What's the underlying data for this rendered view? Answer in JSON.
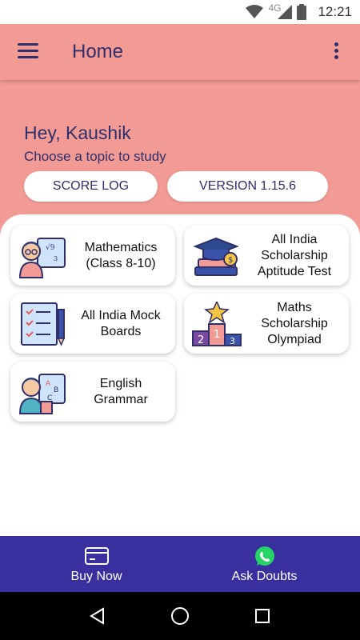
{
  "status_bar": {
    "network": "4G",
    "time": "12:21"
  },
  "app_bar": {
    "title": "Home"
  },
  "greeting": {
    "hello": "Hey, Kaushik",
    "subtitle": "Choose a topic to study"
  },
  "actions": {
    "score_log": "SCORE LOG",
    "version": "VERSION 1.15.6"
  },
  "topics": [
    {
      "label": "Mathematics (Class 8-10)",
      "icon": "student-math-icon"
    },
    {
      "label": "All India Scholarship Aptitude Test",
      "icon": "graduation-books-icon"
    },
    {
      "label": "All India Mock Boards",
      "icon": "checklist-pen-icon"
    },
    {
      "label": "Maths Scholarship Olympiad",
      "icon": "podium-star-icon"
    },
    {
      "label": "English Grammar",
      "icon": "student-abc-icon"
    }
  ],
  "bottom_nav": {
    "buy": "Buy Now",
    "ask": "Ask Doubts"
  },
  "colors": {
    "header": "#f29a94",
    "bottom_bar": "#3a2f9e",
    "text_dark": "#2e2f6b"
  }
}
